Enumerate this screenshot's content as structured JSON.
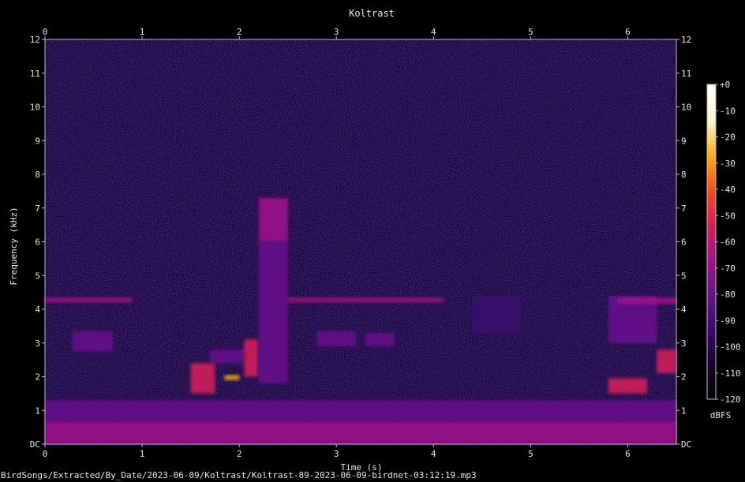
{
  "chart_data": {
    "type": "heatmap",
    "title": "Koltrast",
    "xlabel": "Time (s)",
    "ylabel": "Frequency (kHz)",
    "xlim": [
      0,
      6.5
    ],
    "ylim": [
      0,
      12
    ],
    "x_ticks": [
      "0",
      "1",
      "2",
      "3",
      "4",
      "5",
      "6"
    ],
    "y_ticks": [
      "DC",
      "1",
      "2",
      "3",
      "4",
      "5",
      "6",
      "7",
      "8",
      "9",
      "10",
      "11",
      "12"
    ],
    "colorbar": {
      "label": "dBFS",
      "ticks": [
        "+0",
        "-10",
        "-20",
        "-30",
        "-40",
        "-50",
        "-60",
        "-70",
        "-80",
        "-90",
        "-100",
        "-110",
        "-120"
      ],
      "range": [
        -120,
        0
      ],
      "colormap": [
        "#000000",
        "#1a0033",
        "#3b0a6e",
        "#6a1191",
        "#a3138c",
        "#d91e5b",
        "#f5501a",
        "#fbb019",
        "#fffad0",
        "#ffffff"
      ]
    },
    "energy_regions": [
      {
        "t": [
          0.0,
          6.5
        ],
        "f": [
          0.0,
          0.7
        ],
        "level": -65
      },
      {
        "t": [
          0.0,
          6.5
        ],
        "f": [
          0.7,
          1.3
        ],
        "level": -85
      },
      {
        "t": [
          0.0,
          0.9
        ],
        "f": [
          4.2,
          4.35
        ],
        "level": -70
      },
      {
        "t": [
          0.28,
          0.7
        ],
        "f": [
          2.75,
          3.35
        ],
        "level": -75
      },
      {
        "t": [
          1.5,
          1.75
        ],
        "f": [
          1.5,
          2.4
        ],
        "level": -55
      },
      {
        "t": [
          1.7,
          2.05
        ],
        "f": [
          2.4,
          2.8
        ],
        "level": -75
      },
      {
        "t": [
          1.85,
          2.0
        ],
        "f": [
          1.9,
          2.05
        ],
        "level": -25
      },
      {
        "t": [
          2.05,
          2.2
        ],
        "f": [
          2.0,
          3.1
        ],
        "level": -60
      },
      {
        "t": [
          2.2,
          2.5
        ],
        "f": [
          1.8,
          6.0
        ],
        "level": -85
      },
      {
        "t": [
          2.2,
          2.5
        ],
        "f": [
          6.0,
          7.3
        ],
        "level": -70
      },
      {
        "t": [
          2.5,
          4.1
        ],
        "f": [
          4.2,
          4.35
        ],
        "level": -72
      },
      {
        "t": [
          2.8,
          3.2
        ],
        "f": [
          2.9,
          3.35
        ],
        "level": -78
      },
      {
        "t": [
          3.3,
          3.6
        ],
        "f": [
          2.9,
          3.3
        ],
        "level": -80
      },
      {
        "t": [
          4.4,
          4.9
        ],
        "f": [
          3.3,
          4.4
        ],
        "level": -90
      },
      {
        "t": [
          5.8,
          6.3
        ],
        "f": [
          3.0,
          4.4
        ],
        "level": -85
      },
      {
        "t": [
          5.9,
          6.5
        ],
        "f": [
          4.15,
          4.35
        ],
        "level": -72
      },
      {
        "t": [
          5.8,
          6.2
        ],
        "f": [
          1.5,
          1.95
        ],
        "level": -60
      },
      {
        "t": [
          6.3,
          6.5
        ],
        "f": [
          2.1,
          2.8
        ],
        "level": -50
      }
    ]
  },
  "footer": {
    "filename": "BirdSongs/Extracted/By_Date/2023-06-09/Koltrast/Koltrast-89-2023-06-09-birdnet-03:12:19.mp3"
  }
}
